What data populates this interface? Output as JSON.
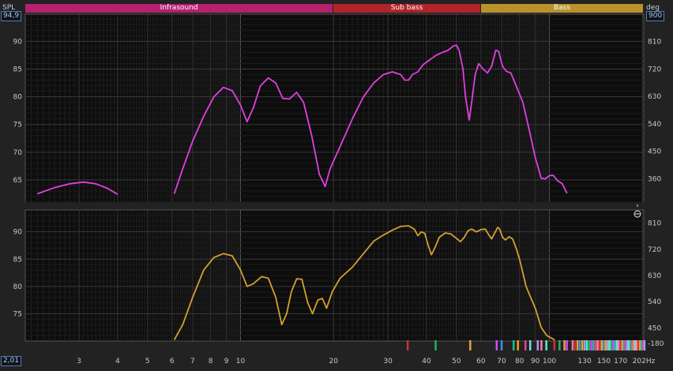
{
  "header": {
    "spl_label": "SPL",
    "deg_label": "deg",
    "spl_box": "94,9",
    "deg_box": "900",
    "freq_box": "2,01",
    "bands": [
      {
        "label": "Infrasound",
        "color": "#b5206f",
        "from": 2.01,
        "to": 20
      },
      {
        "label": "Sub bass",
        "color": "#b0242a",
        "from": 20,
        "to": 60
      },
      {
        "label": "Bass",
        "color": "#b9922b",
        "from": 60,
        "to": 202
      }
    ]
  },
  "phase_icon": "phase-theta-icon",
  "chart_data": [
    {
      "type": "line",
      "panel": "top",
      "x_scale": "log",
      "xlim": [
        2.01,
        202
      ],
      "ylim": [
        61,
        94.9
      ],
      "y_ticks": [
        65,
        70,
        75,
        80,
        85,
        90
      ],
      "y2_ticks": [
        360,
        450,
        540,
        630,
        720,
        810
      ],
      "color": "#e040e0",
      "segments": [
        [
          [
            2.2,
            62.5
          ],
          [
            2.5,
            63.6
          ],
          [
            2.8,
            64.3
          ],
          [
            3.1,
            64.6
          ],
          [
            3.4,
            64.3
          ],
          [
            3.7,
            63.5
          ],
          [
            4.0,
            62.4
          ]
        ],
        [
          [
            6.1,
            62.5
          ],
          [
            6.5,
            67
          ],
          [
            7.0,
            72
          ],
          [
            7.6,
            76.5
          ],
          [
            8.2,
            80
          ],
          [
            8.8,
            81.7
          ],
          [
            9.4,
            81.1
          ],
          [
            10.0,
            78.5
          ],
          [
            10.5,
            75.5
          ],
          [
            11.0,
            78
          ],
          [
            11.6,
            82
          ],
          [
            12.3,
            83.4
          ],
          [
            13.0,
            82.5
          ],
          [
            13.7,
            79.7
          ],
          [
            14.4,
            79.6
          ],
          [
            15.2,
            80.8
          ],
          [
            16.0,
            79
          ],
          [
            17.0,
            73
          ],
          [
            18.0,
            66
          ],
          [
            18.8,
            63.8
          ],
          [
            19.5,
            67
          ],
          [
            21,
            71
          ],
          [
            23,
            76
          ],
          [
            25,
            80
          ],
          [
            27,
            82.5
          ],
          [
            29,
            84
          ],
          [
            31,
            84.5
          ],
          [
            33,
            84
          ],
          [
            34,
            83
          ],
          [
            35,
            83
          ],
          [
            36,
            84
          ],
          [
            37.5,
            84.5
          ],
          [
            39,
            85.8
          ],
          [
            41,
            86.7
          ],
          [
            43,
            87.5
          ],
          [
            45,
            88
          ],
          [
            47,
            88.4
          ],
          [
            49,
            89.2
          ],
          [
            50,
            89.3
          ],
          [
            51,
            88.4
          ],
          [
            52.5,
            85
          ],
          [
            53.5,
            80
          ],
          [
            55,
            75.8
          ],
          [
            56,
            79
          ],
          [
            57.5,
            84
          ],
          [
            59,
            86
          ],
          [
            61,
            85
          ],
          [
            63,
            84.3
          ],
          [
            65,
            85.5
          ],
          [
            67,
            88.4
          ],
          [
            68.5,
            88.2
          ],
          [
            70.5,
            85.5
          ],
          [
            72.5,
            84.6
          ],
          [
            75,
            84.3
          ],
          [
            78,
            82
          ],
          [
            82,
            79
          ],
          [
            86,
            74
          ],
          [
            90,
            69
          ],
          [
            94,
            65.3
          ],
          [
            97,
            65.2
          ],
          [
            100,
            65.8
          ],
          [
            103,
            65.8
          ],
          [
            106,
            64.9
          ],
          [
            110,
            64.3
          ],
          [
            114,
            62.6
          ]
        ]
      ]
    },
    {
      "type": "line",
      "panel": "bottom",
      "x_scale": "log",
      "xlim": [
        2.01,
        202
      ],
      "ylim": [
        70,
        94
      ],
      "y_ticks": [
        75,
        80,
        85,
        90
      ],
      "y2_ticks": [
        -180,
        450,
        540,
        630,
        720,
        810
      ],
      "x_ticks": [
        3,
        4,
        5,
        6,
        7,
        8,
        9,
        10,
        20,
        30,
        40,
        50,
        60,
        70,
        80,
        90,
        100,
        130,
        150,
        170
      ],
      "x_end_label": "202Hz",
      "color": "#d4a030",
      "segments": [
        [
          [
            6.1,
            70.2
          ],
          [
            6.5,
            73
          ],
          [
            7.0,
            78
          ],
          [
            7.6,
            83
          ],
          [
            8.2,
            85.3
          ],
          [
            8.8,
            86
          ],
          [
            9.4,
            85.6
          ],
          [
            10.0,
            83
          ],
          [
            10.5,
            80
          ],
          [
            11.0,
            80.5
          ],
          [
            11.7,
            81.8
          ],
          [
            12.3,
            81.5
          ],
          [
            13.0,
            78
          ],
          [
            13.6,
            73
          ],
          [
            14.1,
            75
          ],
          [
            14.6,
            79
          ],
          [
            15.2,
            81.4
          ],
          [
            15.8,
            81.3
          ],
          [
            16.5,
            77
          ],
          [
            17.1,
            75
          ],
          [
            17.8,
            77.5
          ],
          [
            18.4,
            77.8
          ],
          [
            19.0,
            76
          ],
          [
            19.8,
            79
          ],
          [
            21,
            81.5
          ],
          [
            23,
            83.5
          ],
          [
            25,
            86
          ],
          [
            27,
            88.3
          ],
          [
            29,
            89.4
          ],
          [
            31,
            90.3
          ],
          [
            33,
            91
          ],
          [
            35,
            91.1
          ],
          [
            36.5,
            90.5
          ],
          [
            37.5,
            89.3
          ],
          [
            38.5,
            90
          ],
          [
            39.5,
            89.7
          ],
          [
            40.5,
            87.5
          ],
          [
            41.5,
            85.8
          ],
          [
            42.5,
            87
          ],
          [
            44,
            89
          ],
          [
            46,
            89.8
          ],
          [
            48,
            89.6
          ],
          [
            50,
            88.8
          ],
          [
            51.5,
            88.2
          ],
          [
            53,
            89
          ],
          [
            54.5,
            90.2
          ],
          [
            56,
            90.5
          ],
          [
            58,
            90
          ],
          [
            60,
            90.4
          ],
          [
            62,
            90.5
          ],
          [
            63.5,
            89.5
          ],
          [
            65,
            88.7
          ],
          [
            66.5,
            89.8
          ],
          [
            68,
            90.8
          ],
          [
            69,
            90.5
          ],
          [
            70.5,
            89
          ],
          [
            72,
            88.5
          ],
          [
            74,
            89.1
          ],
          [
            76,
            88.7
          ],
          [
            78,
            87
          ],
          [
            80,
            85
          ],
          [
            82,
            82.5
          ],
          [
            84,
            80
          ],
          [
            86,
            78.6
          ],
          [
            90,
            76
          ],
          [
            94,
            72.5
          ],
          [
            98,
            71
          ],
          [
            104,
            70.2
          ]
        ]
      ]
    }
  ]
}
